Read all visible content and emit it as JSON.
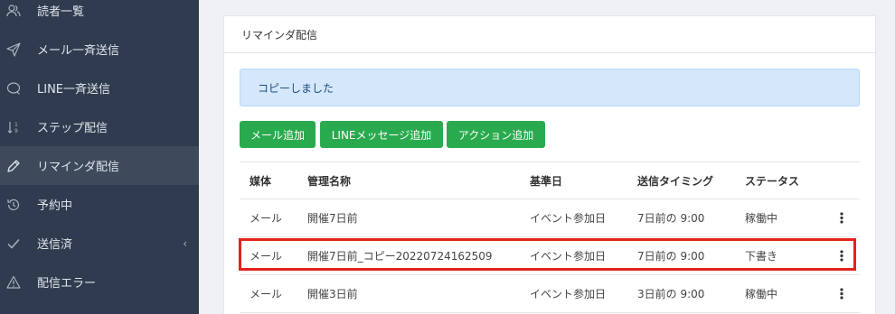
{
  "sidebar": {
    "items": [
      {
        "label": "読者一覧",
        "icon": "people-icon"
      },
      {
        "label": "メール一斉送信",
        "icon": "send-icon"
      },
      {
        "label": "LINE一斉送信",
        "icon": "chat-bubble-icon"
      },
      {
        "label": "ステップ配信",
        "icon": "sort-order-icon"
      },
      {
        "label": "リマインダ配信",
        "icon": "pencil-icon"
      },
      {
        "label": "予約中",
        "icon": "history-icon"
      },
      {
        "label": "送信済",
        "icon": "check-icon"
      },
      {
        "label": "配信エラー",
        "icon": "warning-icon"
      }
    ],
    "active_index": 4,
    "caret": "‹"
  },
  "card": {
    "title": "リマインダ配信",
    "alert": "コピーしました",
    "buttons": {
      "add_mail": "メール追加",
      "add_line": "LINEメッセージ追加",
      "add_action": "アクション追加"
    },
    "columns": [
      "媒体",
      "管理名称",
      "基準日",
      "送信タイミング",
      "ステータス"
    ],
    "rows": [
      [
        "メール",
        "開催7日前",
        "イベント参加日",
        "7日前の 9:00",
        "稼働中"
      ],
      [
        "メール",
        "開催7日前_コピー20220724162509",
        "イベント参加日",
        "7日前の 9:00",
        "下書き"
      ],
      [
        "メール",
        "開催3日前",
        "イベント参加日",
        "3日前の 9:00",
        "稼働中"
      ]
    ],
    "highlighted_row": 1
  },
  "colors": {
    "sidebar_bg": "#2f3c4f",
    "button_green": "#2aaa4e",
    "alert_bg": "#d4e7fb",
    "highlight_red": "#e2231a"
  }
}
